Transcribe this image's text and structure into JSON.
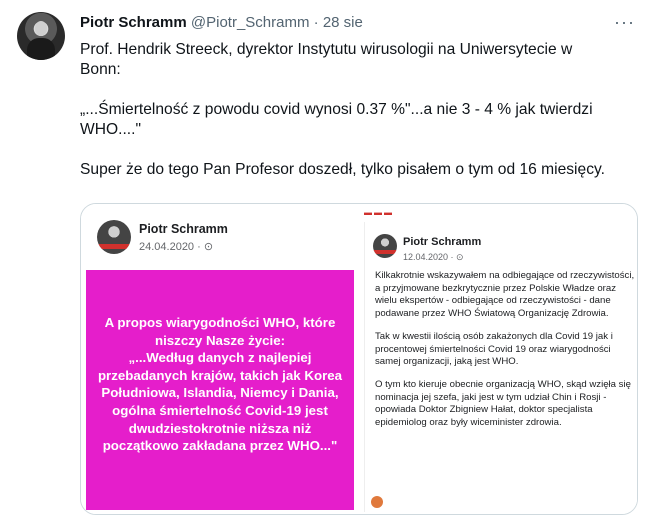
{
  "tweet": {
    "author_name": "Piotr Schramm",
    "handle": "@Piotr_Schramm",
    "separator": "·",
    "date": "28 sie",
    "more_icon": "more-icon",
    "text": {
      "p1_line1": "Prof. Hendrik Streeck, dyrektor Instytutu wirusologii na Uniwersytecie w",
      "p1_line2": "Bonn:",
      "p2_line1": "„...Śmiertelność z powodu covid wynosi 0.37 %\"...a nie 3 - 4 % jak twierdzi",
      "p2_line2": "WHO....\"",
      "p3": "Super że do tego Pan Profesor doszedł, tylko pisałem o tym od 16 miesięcy."
    }
  },
  "media": {
    "left_post": {
      "name": "Piotr Schramm",
      "date": "24.04.2020 · ⊙",
      "image_lines": [
        "A propos wiarygodności WHO, które",
        "niszczy Nasze życie:",
        "„...Według danych z najlepiej",
        "przebadanych krajów, takich jak Korea",
        "Południowa, Islandia, Niemcy i Dania,",
        "ogólna śmiertelność Covid-19 jest",
        "dwudziestokrotnie niższa niż",
        "początkowo zakładana przez WHO...\""
      ],
      "bg_color": "#e51ecb"
    },
    "right_post": {
      "name": "Piotr Schramm",
      "date": "12.04.2020 · ⊙",
      "paragraphs": [
        "Kilkakrotnie wskazywałem na odbiegające od rzeczywistości, a przyjmowane bezkrytycznie przez Polskie Władze oraz wielu ekspertów - odbiegające od rzeczywistości - dane podawane przez WHO Światową Organizację Zdrowia.",
        "Tak w kwestii ilością osób zakażonych dla Covid 19 jak i procentowej śmiertelności Covid 19 oraz wiarygodności samej organizacji, jaką jest WHO.",
        "O tym kto kieruje obecnie organizacją WHO, skąd wzięła się nominacja jej szefa, jaki jest w tym udział Chin i Rosji - opowiada Doktor Zbigniew Hałat, doktor specjalista epidemiolog oraz były wiceminister zdrowia."
      ]
    }
  }
}
